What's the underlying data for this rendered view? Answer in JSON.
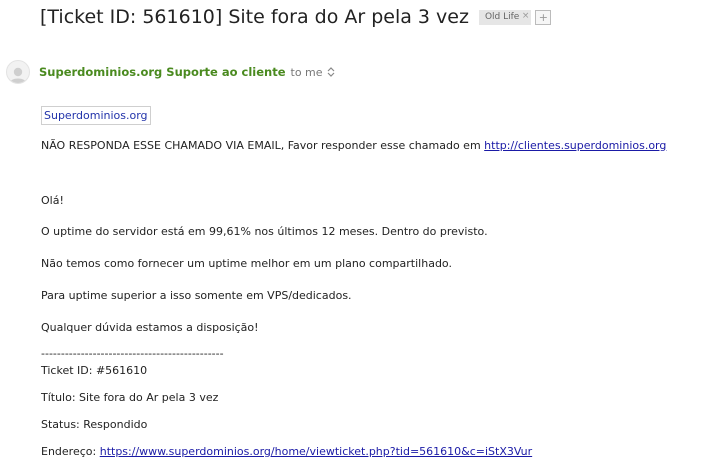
{
  "header": {
    "subject": "[Ticket ID: 561610] Site fora do Ar pela 3 vez",
    "label": "Old Life",
    "add_label": "+"
  },
  "sender": {
    "name": "Superdominios.org Suporte ao cliente",
    "to": "to me"
  },
  "message": {
    "brand_link": "Superdominios.org",
    "notice": "NÃO RESPONDA ESSE CHAMADO VIA EMAIL, Favor responder esse chamado em",
    "notice_link": "http://clientes.superdominios.org",
    "greeting": "Olá!",
    "p1": "O uptime do servidor está em 99,61% nos últimos 12 meses. Dentro do previsto.",
    "p2": "Não temos como fornecer um uptime melhor em um plano compartilhado.",
    "p3": "Para uptime superior a isso somente em VPS/dedicados.",
    "p4": "Qualquer dúvida estamos a disposição!",
    "separator": "----------------------------------------------",
    "ticket_id": "Ticket ID: #561610",
    "title": "Título: Site fora do Ar pela 3 vez",
    "status": "Status: Respondido",
    "address_label": "Endereço:",
    "address_link": "https://www.superdominios.org/home/viewticket.php?tid=561610&c=iStX3Vur"
  }
}
